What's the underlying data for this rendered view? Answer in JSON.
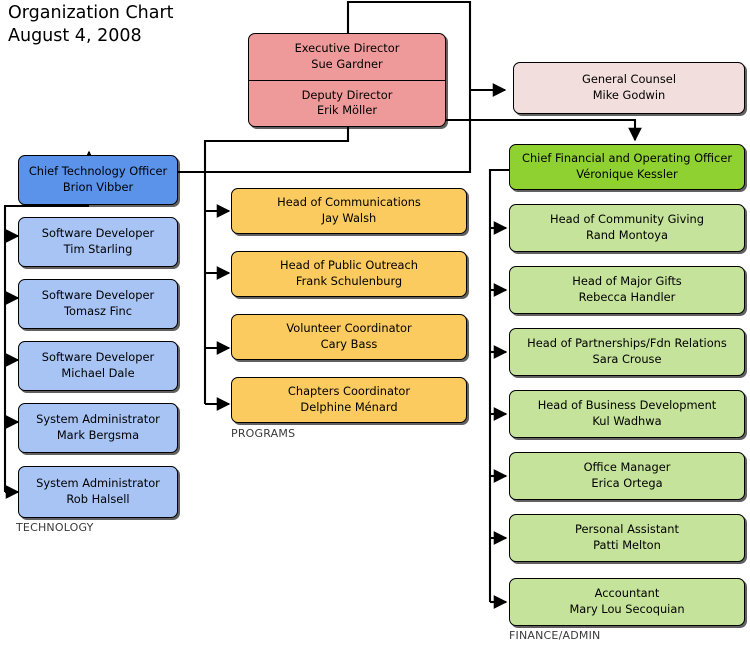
{
  "title": {
    "line1": "Organization Chart",
    "line2": "August 4, 2008"
  },
  "colors": {
    "executive_fill": "#ef9a9a",
    "counsel_fill": "#f2dedc",
    "technology_head_fill": "#5b92ea",
    "technology_fill": "#a8c4f5",
    "programs_fill": "#fbcb5f",
    "finance_head_fill": "#8fd130",
    "finance_fill": "#c5e39a",
    "stroke": "#000000",
    "background": "#ffffff"
  },
  "executive": {
    "director": {
      "role": "Executive Director",
      "person": "Sue Gardner"
    },
    "deputy": {
      "role": "Deputy Director",
      "person": "Erik Möller"
    }
  },
  "counsel": {
    "role": "General Counsel",
    "person": "Mike Godwin"
  },
  "technology": {
    "group_label": "TECHNOLOGY",
    "head": {
      "role": "Chief Technology Officer",
      "person": "Brion Vibber"
    },
    "members": [
      {
        "role": "Software Developer",
        "person": "Tim Starling"
      },
      {
        "role": "Software Developer",
        "person": "Tomasz Finc"
      },
      {
        "role": "Software Developer",
        "person": "Michael Dale"
      },
      {
        "role": "System Administrator",
        "person": "Mark Bergsma"
      },
      {
        "role": "System Administrator",
        "person": "Rob Halsell"
      }
    ]
  },
  "programs": {
    "group_label": "PROGRAMS",
    "members": [
      {
        "role": "Head of Communications",
        "person": "Jay Walsh"
      },
      {
        "role": "Head of Public Outreach",
        "person": "Frank Schulenburg"
      },
      {
        "role": "Volunteer Coordinator",
        "person": "Cary Bass"
      },
      {
        "role": "Chapters Coordinator",
        "person": "Delphine Ménard"
      }
    ]
  },
  "finance": {
    "group_label": "FINANCE/ADMIN",
    "head": {
      "role": "Chief Financial and Operating Officer",
      "person": "Véronique Kessler"
    },
    "members": [
      {
        "role": "Head of Community Giving",
        "person": "Rand Montoya"
      },
      {
        "role": "Head of Major Gifts",
        "person": "Rebecca Handler"
      },
      {
        "role": "Head of Partnerships/Fdn Relations",
        "person": "Sara Crouse"
      },
      {
        "role": "Head of Business Development",
        "person": "Kul Wadhwa"
      },
      {
        "role": "Office Manager",
        "person": "Erica Ortega"
      },
      {
        "role": "Personal Assistant",
        "person": "Patti Melton"
      },
      {
        "role": "Accountant",
        "person": "Mary Lou Secoquian"
      }
    ]
  }
}
